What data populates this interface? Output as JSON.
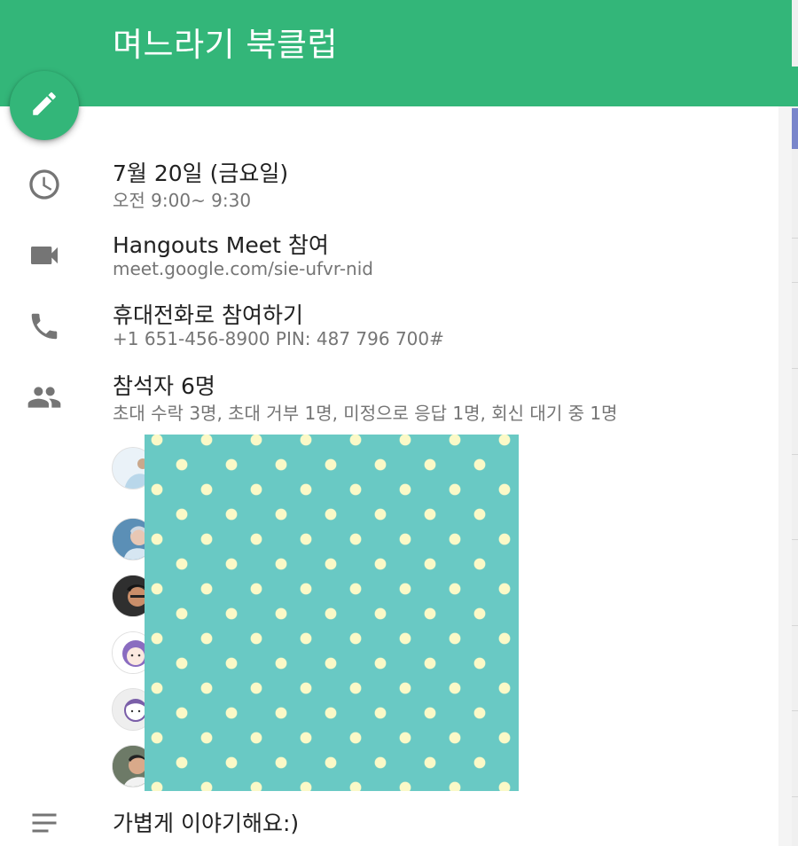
{
  "event": {
    "title": "며느라기 북클럽",
    "date": "7월 20일 (금요일)",
    "time": "오전 9:00~ 9:30",
    "meet_label": "Hangouts Meet 참여",
    "meet_link": "meet.google.com/sie-ufvr-nid",
    "phone_label": "휴대전화로 참여하기",
    "phone_number": "+1 651-456-8900 PIN: 487 796 700#",
    "attendees_label": "참석자 6명",
    "attendees_summary": "초대 수락 3명, 초대 거부 1명, 미정으로 응답 1명, 회신 대기 중 1명",
    "description": "가볍게 이야기해요:)"
  },
  "icons": {
    "edit": "pencil-icon",
    "time": "clock-icon",
    "video": "video-camera-icon",
    "phone": "phone-icon",
    "people": "people-icon",
    "description": "notes-icon"
  },
  "colors": {
    "header": "#33b679",
    "overlay_bg": "#69c9c4",
    "overlay_dots": "#fbf9c7",
    "icon_gray": "#757575"
  }
}
